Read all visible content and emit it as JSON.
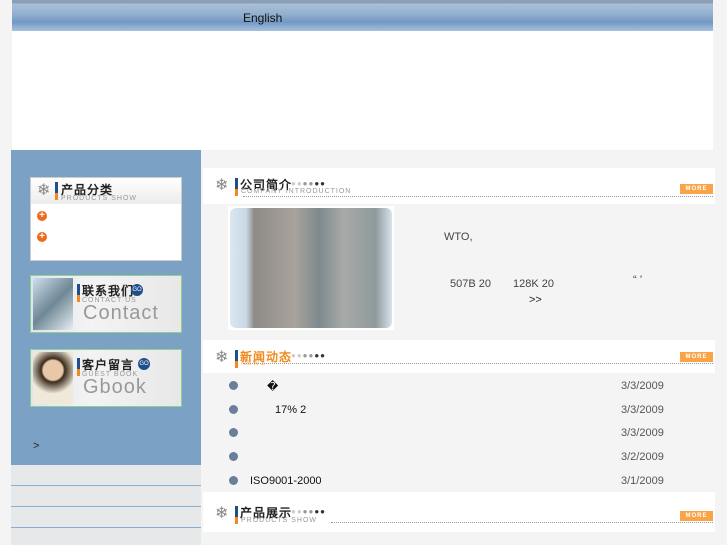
{
  "header": {
    "language_link": "English"
  },
  "sidebar": {
    "products": {
      "title": "产品分类",
      "subtitle": "PRODUCTS SHOW"
    },
    "contact": {
      "title": "联系我们",
      "subtitle": "CONTACT US",
      "big": "Contact",
      "go": "GO"
    },
    "gbook": {
      "title": "客户留言",
      "subtitle": "GUEST BOOK",
      "big": "Gbook",
      "go": "GO"
    },
    "arrow": ">"
  },
  "company": {
    "title": "公司简介",
    "subtitle": "COMPANY INTRODUCTION",
    "more": "MORE",
    "text1": "WTO,",
    "t2": "507B 20",
    "t3": "128K 20",
    "t4": "“ ’",
    "more_link": ">>"
  },
  "news": {
    "title": "新闻动态",
    "subtitle": "NEWS",
    "more": "MORE",
    "items": [
      {
        "title": "�",
        "date": "3/3/2009"
      },
      {
        "title": "17% 2",
        "date": "3/3/2009"
      },
      {
        "title": "",
        "date": "3/3/2009"
      },
      {
        "title": "",
        "date": "3/2/2009"
      },
      {
        "title": "ISO9001-2000",
        "date": "3/1/2009"
      }
    ]
  },
  "products_show": {
    "title": "产品展示",
    "subtitle": "PRODUCTS SHOW",
    "more": "MORE"
  }
}
